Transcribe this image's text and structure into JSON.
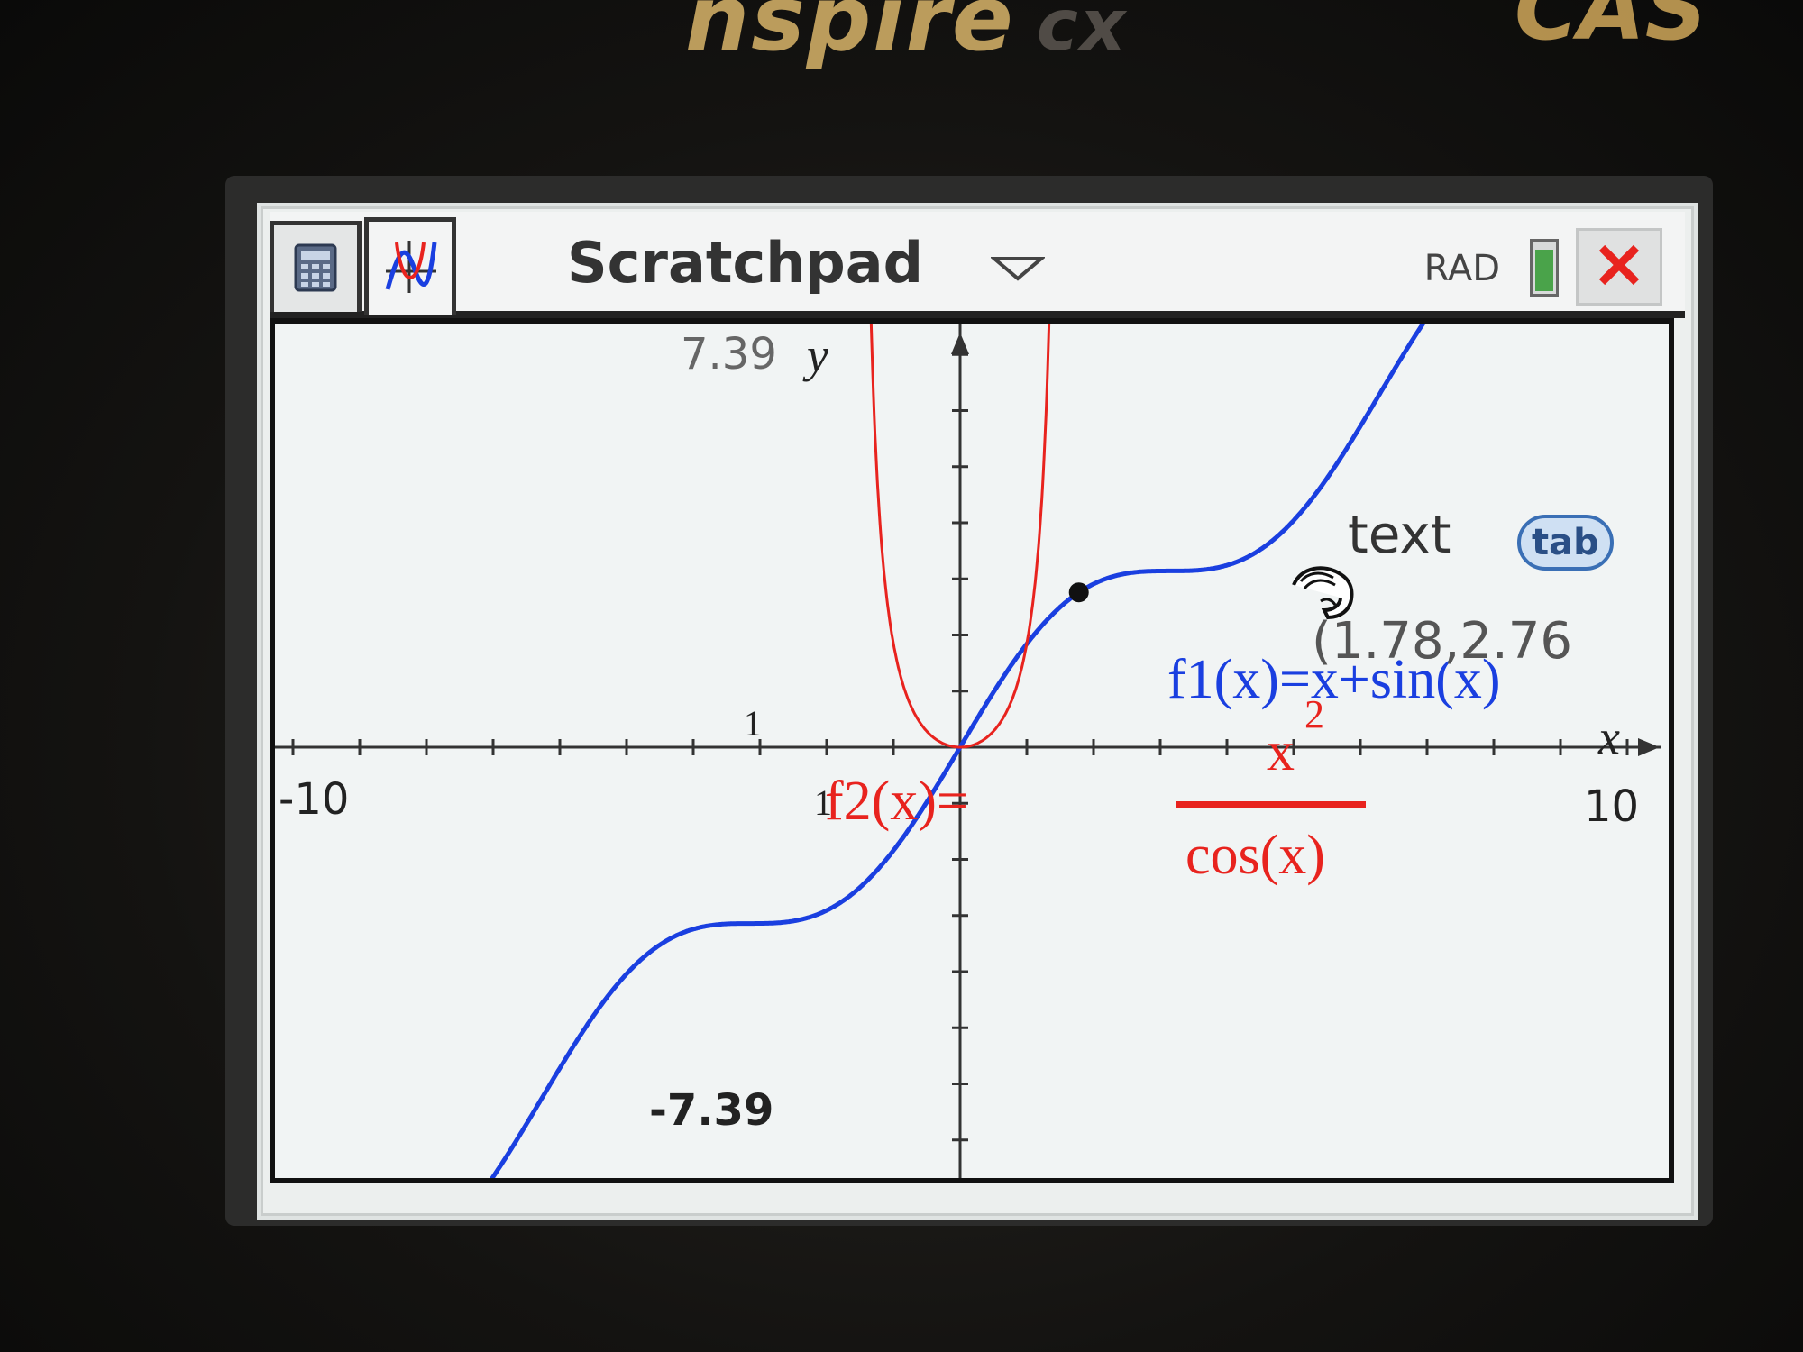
{
  "device": {
    "brand_text": "nspire",
    "model_suffix": "cx",
    "cas_text": "CAS"
  },
  "titlebar": {
    "tab_calculator_icon": "calculator-icon",
    "tab_graph_icon": "graph-icon",
    "title": "Scratchpad",
    "menu_icon": "chevron-down-icon",
    "angle_mode": "RAD",
    "battery_level": 0.8,
    "close_icon": "close-icon"
  },
  "graph": {
    "window": {
      "xmin": -10,
      "xmax": 10,
      "ymin": -7.39,
      "ymax": 7.39
    },
    "labels": {
      "ymax": "7.39",
      "ymin": "-7.39",
      "xmin": "-10",
      "xmax": "10",
      "ytick": "1",
      "xtick": "1",
      "x_axis": "x",
      "y_axis": "y"
    },
    "functions": [
      {
        "id": "f1",
        "expr_label": "f1(x)=x+sin(x)",
        "color": "#1a3fe0"
      },
      {
        "id": "f2",
        "name_label": "f2(x)=",
        "numerator": "x",
        "exponent": "2",
        "denominator": "cos(x)",
        "color": "#e8231e"
      }
    ],
    "trace_point": {
      "x": 1.78,
      "y": 2.76,
      "label": "(1.78,2.76"
    },
    "text_hint": "text",
    "tab_key": "tab",
    "cursor_icon": "grab-hand-icon"
  }
}
